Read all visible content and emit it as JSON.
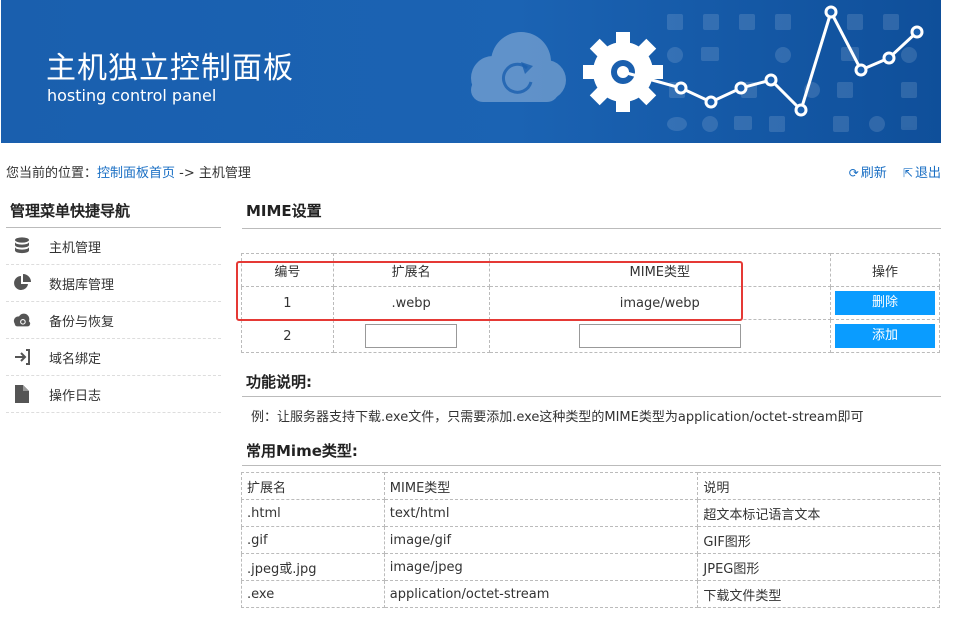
{
  "banner": {
    "title": "主机独立控制面板",
    "subtitle": "hosting control panel"
  },
  "breadcrumb": {
    "prefix": "您当前的位置：",
    "home_link": "控制面板首页",
    "separator": " -> ",
    "current": "主机管理"
  },
  "top_actions": {
    "refresh": "刷新",
    "logout": "退出"
  },
  "sidebar": {
    "title": "管理菜单快捷导航",
    "items": [
      {
        "label": "主机管理",
        "icon": "database-icon"
      },
      {
        "label": "数据库管理",
        "icon": "pie-chart-icon"
      },
      {
        "label": "备份与恢复",
        "icon": "cloud-sync-icon"
      },
      {
        "label": "域名绑定",
        "icon": "sign-in-icon"
      },
      {
        "label": "操作日志",
        "icon": "file-icon"
      }
    ]
  },
  "mime_section": {
    "title": "MIME设置",
    "headers": [
      "编号",
      "扩展名",
      "MIME类型",
      "操作"
    ],
    "rows": [
      {
        "id": "1",
        "ext": ".webp",
        "type": "image/webp",
        "action": "删除"
      }
    ],
    "new_row": {
      "id": "2",
      "ext_value": "",
      "type_value": "",
      "action": "添加"
    }
  },
  "func_section": {
    "title": "功能说明:",
    "text": "例：让服务器支持下载.exe文件，只需要添加.exe这种类型的MIME类型为application/octet-stream即可"
  },
  "common_section": {
    "title": "常用Mime类型:",
    "headers": [
      "扩展名",
      "MIME类型",
      "说明"
    ],
    "rows": [
      [
        ".html",
        "text/html",
        "超文本标记语言文本"
      ],
      [
        ".gif",
        "image/gif",
        "GIF图形"
      ],
      [
        ".jpeg或.jpg",
        "image/jpeg",
        "JPEG图形"
      ],
      [
        ".exe",
        "application/octet-stream",
        "下载文件类型"
      ]
    ]
  },
  "colors": {
    "banner_blue": "#1a5fae",
    "link_blue": "#1a6fc4",
    "button_blue": "#0a9cff",
    "highlight_red": "#e53935"
  }
}
